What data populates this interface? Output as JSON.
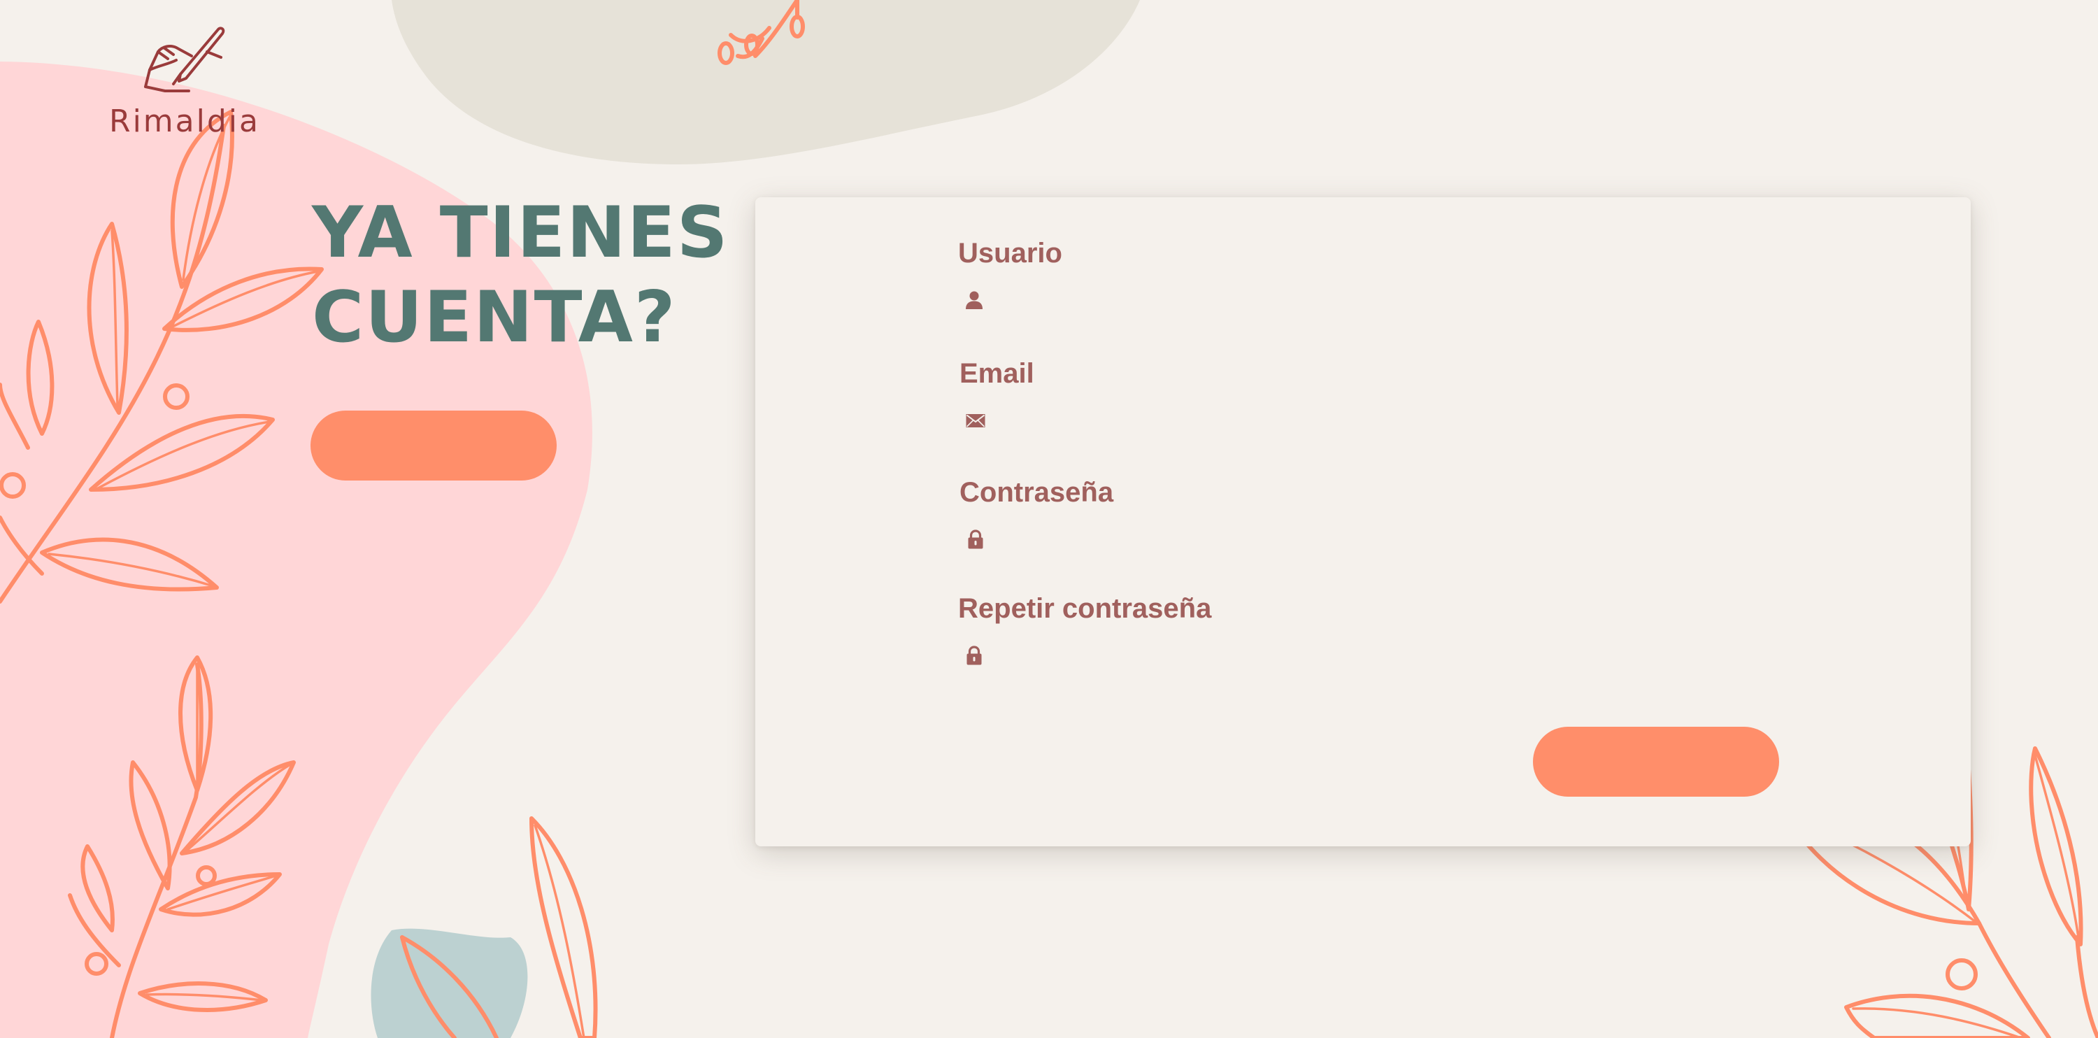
{
  "brand": {
    "name": "Rimaldia"
  },
  "login_panel": {
    "headline_line1": "YA TIENES",
    "headline_line2": "CUENTA?",
    "button_label": ""
  },
  "register_form": {
    "fields": [
      {
        "label": "Usuario",
        "icon": "user-icon",
        "value": ""
      },
      {
        "label": "Email",
        "icon": "envelope-icon",
        "value": ""
      },
      {
        "label": "Contraseña",
        "icon": "lock-icon",
        "value": ""
      },
      {
        "label": "Repetir contraseña",
        "icon": "lock-icon",
        "value": ""
      }
    ],
    "submit_label": ""
  },
  "colors": {
    "background": "#f5f1ec",
    "accent": "#ff8e6a",
    "headline": "#537872",
    "label": "#a0605d",
    "blob_pink": "#ffd6d7",
    "blob_beige": "#e6e2d8",
    "blob_teal": "#bcd1d1"
  }
}
